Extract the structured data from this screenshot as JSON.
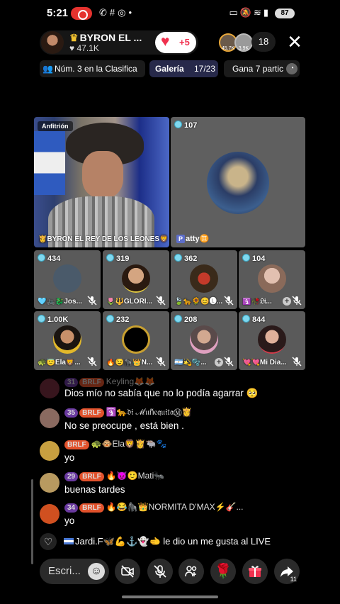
{
  "status_bar": {
    "time": "5:21",
    "battery": "87"
  },
  "host": {
    "name": "BYRON EL ...",
    "likes": "47.1K",
    "follow_count": "+5"
  },
  "viewers": {
    "count": "18",
    "avatar_labels": [
      "45.7K",
      "3.9K"
    ]
  },
  "chips": {
    "rank": "Núm. 3 en la Clasifica",
    "gallery_label": "Galería",
    "gallery_count": "17/23",
    "win": "Gana 7 partic"
  },
  "host_tile": {
    "badge": "Anfitrión",
    "name": "👸BYRON EL REY DE LOS LEONES🦁"
  },
  "guest_large": {
    "coins": "107",
    "name": "atty",
    "tag": "P",
    "suffix": "♊"
  },
  "guests": [
    {
      "coins": "434",
      "name": "🩵🚲🐉Jos..."
    },
    {
      "coins": "319",
      "name": "🌷🔱GLORI..."
    },
    {
      "coins": "362",
      "name": "🍃🐆🌻😊🅛..."
    },
    {
      "coins": "104",
      "name": "🛐🥀𝔏𝔦..."
    },
    {
      "coins": "1.00K",
      "name": "🐢😇Ela🦁..."
    },
    {
      "coins": "232",
      "name": "🔥😉🦍👑N..."
    },
    {
      "coins": "208",
      "name": "🇦🇷💫🫧..."
    },
    {
      "coins": "844",
      "name": "💘💘Mi Dia..."
    }
  ],
  "chat": [
    {
      "level": "31",
      "fan": "BRLF",
      "user": "Keyling🦊🦊",
      "text": "Dios mío no sabía que no lo podía agarrar 🥺"
    },
    {
      "level": "35",
      "fan": "BRLF",
      "user": "🛐🐆𝔡𝔦 ℳ𝔲ñ𝔢𝔮𝔲𝔦𝔱𝔞Ⓜ👸",
      "text": "No se preocupe , está bien ."
    },
    {
      "level": "",
      "fan": "BRLF",
      "user": "🐢🐵Ela🦁👸🐃🐾",
      "text": "yo"
    },
    {
      "level": "29",
      "fan": "BRLF",
      "user": "🔥😈🙂Mati🐜",
      "text": "buenas tardes"
    },
    {
      "level": "34",
      "fan": "BRLF",
      "user": "🔥😂🦍👑NORMITA D'MAX⚡🎸...",
      "text": "yo"
    }
  ],
  "like_notice": {
    "user": "Jardi.F🦋💪⚓👻🫲",
    "text": "le dio un me gusta al LIVE"
  },
  "bottom": {
    "comment_placeholder": "Escri...",
    "share_count": "11"
  },
  "colors": {
    "accent": "#f0304e",
    "gallery_chip": "#27294a",
    "level_badge": "#6a3aa0",
    "fan_badge": "#e2522c",
    "coin": "#7fd8ef"
  },
  "icons": [
    "notification-icon",
    "whatsapp-icon",
    "hashtag-icon",
    "instagram-icon",
    "cast-icon",
    "mute-icon",
    "wifi-icon",
    "signal-icon",
    "heart-icon",
    "close-icon",
    "people-icon",
    "spinner-icon",
    "coin-icon",
    "mic-off-icon",
    "add-icon",
    "smiley-icon",
    "camera-off-icon",
    "share-icon",
    "gift-icon",
    "rose-icon",
    "guests-icon"
  ]
}
